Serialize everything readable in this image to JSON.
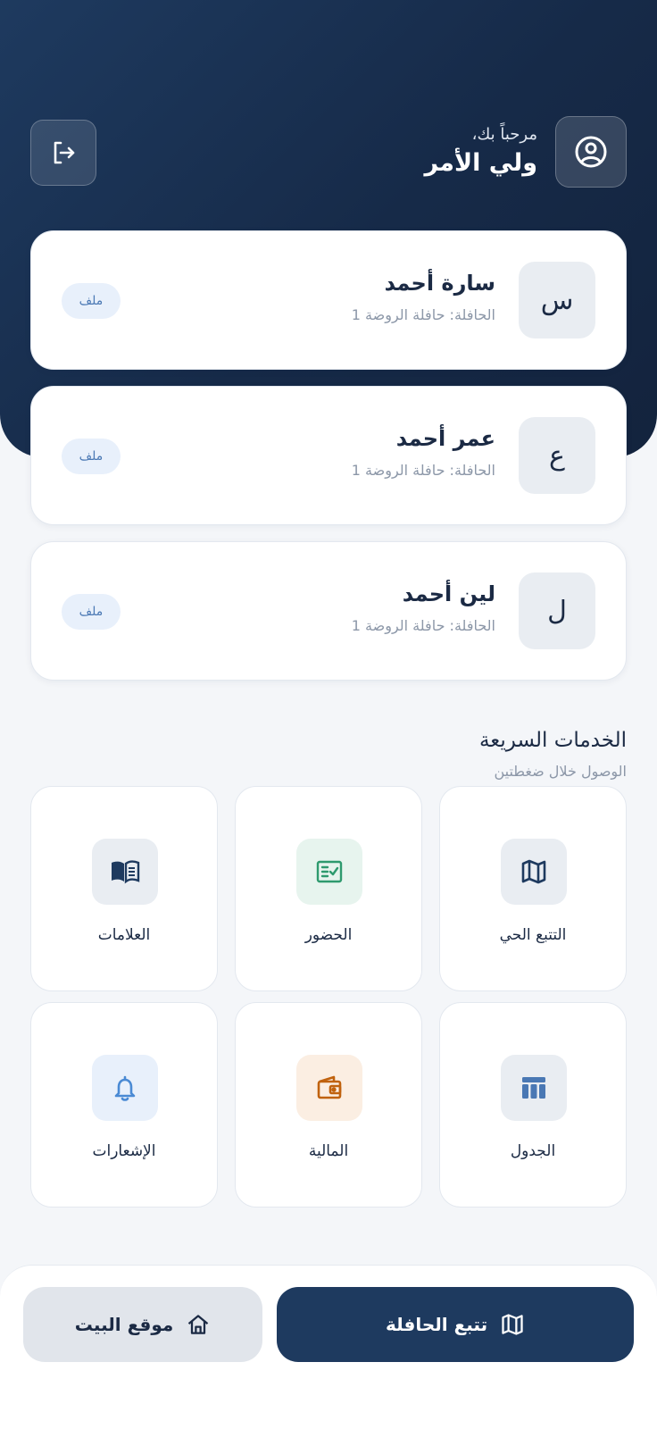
{
  "header": {
    "greeting": "مرحباً بك،",
    "user_role": "ولي الأمر"
  },
  "children": [
    {
      "initial": "س",
      "name": "سارة أحمد",
      "bus": "الحافلة: حافلة الروضة 1",
      "profile_label": "ملف"
    },
    {
      "initial": "ع",
      "name": "عمر أحمد",
      "bus": "الحافلة: حافلة الروضة 1",
      "profile_label": "ملف"
    },
    {
      "initial": "ل",
      "name": "لين أحمد",
      "bus": "الحافلة: حافلة الروضة 1",
      "profile_label": "ملف"
    }
  ],
  "quick_services": {
    "title": "الخدمات السريعة",
    "subtitle": "الوصول خلال ضغطتين",
    "items": [
      {
        "label": "التتبع الحي",
        "icon": "map-icon",
        "color": "#1e3a5f"
      },
      {
        "label": "الحضور",
        "icon": "attendance-icon",
        "color": "#2e9a6e"
      },
      {
        "label": "العلامات",
        "icon": "book-icon",
        "color": "#1e3a5f"
      },
      {
        "label": "الجدول",
        "icon": "schedule-icon",
        "color": "#4a78b4"
      },
      {
        "label": "المالية",
        "icon": "wallet-icon",
        "color": "#c0620e"
      },
      {
        "label": "الإشعارات",
        "icon": "bell-icon",
        "color": "#4a8ad4"
      }
    ]
  },
  "bottom_actions": {
    "track_bus": "تتبع الحافلة",
    "home_location": "موقع البيت"
  }
}
